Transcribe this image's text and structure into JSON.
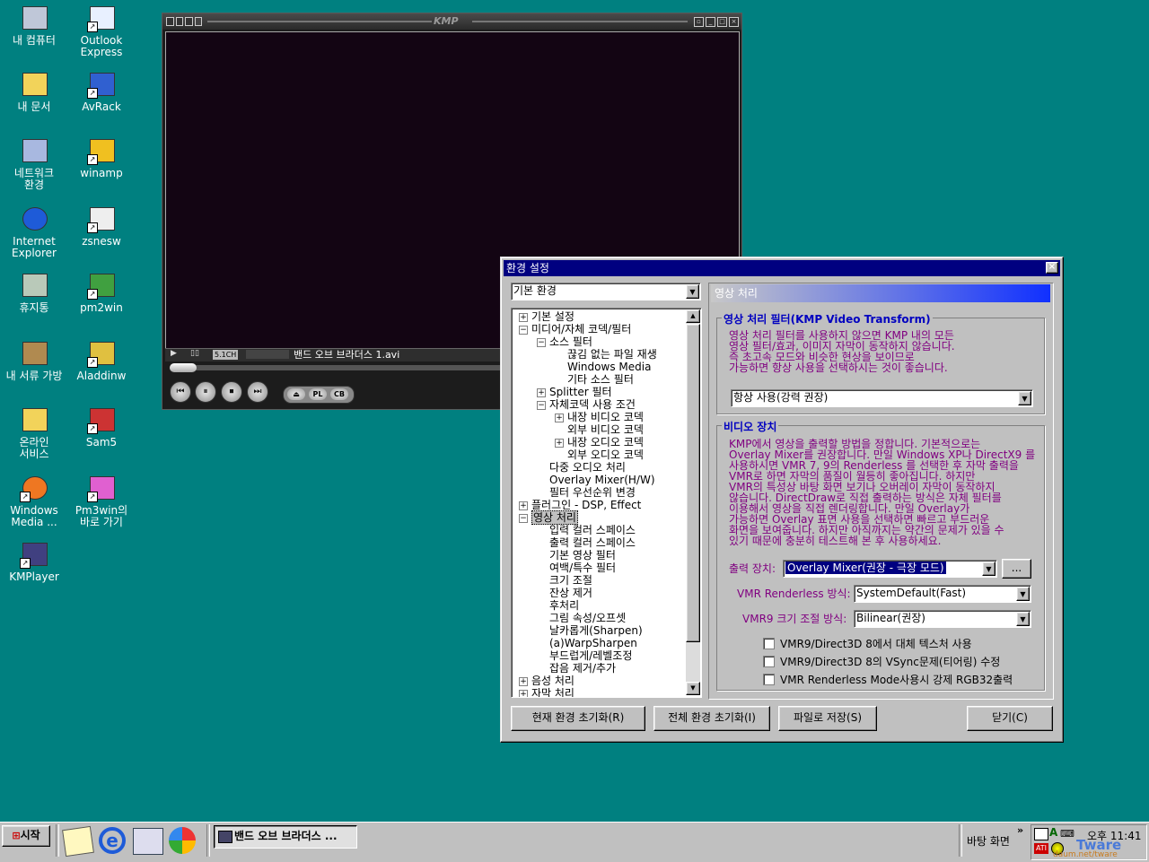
{
  "desktop": {
    "icons": [
      {
        "label": "내 컴퓨터",
        "icon": "computer-icon"
      },
      {
        "label": "Outlook\nExpress",
        "icon": "outlook-icon"
      },
      {
        "label": "내 문서",
        "icon": "folder-icon"
      },
      {
        "label": "AvRack",
        "icon": "avrack-icon"
      },
      {
        "label": "네트워크\n환경",
        "icon": "network-icon"
      },
      {
        "label": "winamp",
        "icon": "winamp-icon"
      },
      {
        "label": "Internet\nExplorer",
        "icon": "ie-icon"
      },
      {
        "label": "zsnesw",
        "icon": "zsnes-icon"
      },
      {
        "label": "휴지통",
        "icon": "recycle-bin-icon"
      },
      {
        "label": "pm2win",
        "icon": "pm2win-icon"
      },
      {
        "label": "내 서류 가방",
        "icon": "briefcase-icon"
      },
      {
        "label": "Aladdinw",
        "icon": "aladdin-icon"
      },
      {
        "label": "온라인\n서비스",
        "icon": "folder-icon"
      },
      {
        "label": "Sam5",
        "icon": "sam5-icon"
      },
      {
        "label": "Windows\nMedia ...",
        "icon": "windows-media-icon"
      },
      {
        "label": "Pm3win의\n바로 가기",
        "icon": "pm3win-icon"
      },
      {
        "label": "KMPlayer",
        "icon": "kmplayer-icon"
      }
    ]
  },
  "player": {
    "title": "KMP",
    "channel_badge": "5.1CH",
    "now_playing": "밴드 오브 브라더스 1.avi",
    "buttons": {
      "eject": "⏏",
      "playlist": "PL",
      "control_box": "CB"
    }
  },
  "dialog": {
    "title": "환경 설정",
    "category_select": "기본 환경",
    "tree": [
      {
        "label": "기본 설정",
        "level": 0,
        "expander": "+"
      },
      {
        "label": "미디어/자체 코덱/필터",
        "level": 0,
        "expander": "-"
      },
      {
        "label": "소스 필터",
        "level": 1,
        "expander": "-"
      },
      {
        "label": "끊김 없는 파일 재생",
        "level": 2,
        "expander": ""
      },
      {
        "label": "Windows Media",
        "level": 2,
        "expander": ""
      },
      {
        "label": "기타 소스 필터",
        "level": 2,
        "expander": ""
      },
      {
        "label": "Splitter 필터",
        "level": 1,
        "expander": "+"
      },
      {
        "label": "자체코덱 사용 조건",
        "level": 1,
        "expander": "-"
      },
      {
        "label": "내장 비디오 코덱",
        "level": 2,
        "expander": "+"
      },
      {
        "label": "외부 비디오 코덱",
        "level": 2,
        "expander": ""
      },
      {
        "label": "내장 오디오 코덱",
        "level": 2,
        "expander": "+"
      },
      {
        "label": "외부 오디오 코덱",
        "level": 2,
        "expander": ""
      },
      {
        "label": "다중 오디오 처리",
        "level": 1,
        "expander": ""
      },
      {
        "label": "Overlay Mixer(H/W)",
        "level": 1,
        "expander": ""
      },
      {
        "label": "필터 우선순위 변경",
        "level": 1,
        "expander": ""
      },
      {
        "label": "플러그인 - DSP, Effect",
        "level": 0,
        "expander": "+"
      },
      {
        "label": "영상 처리",
        "level": 0,
        "expander": "-",
        "selected": true
      },
      {
        "label": "입력 컬러 스페이스",
        "level": 1,
        "expander": ""
      },
      {
        "label": "출력 컬러 스페이스",
        "level": 1,
        "expander": ""
      },
      {
        "label": "기본 영상 필터",
        "level": 1,
        "expander": ""
      },
      {
        "label": "여백/특수 필터",
        "level": 1,
        "expander": ""
      },
      {
        "label": "크기 조절",
        "level": 1,
        "expander": ""
      },
      {
        "label": "잔상 제거",
        "level": 1,
        "expander": ""
      },
      {
        "label": "후처리",
        "level": 1,
        "expander": ""
      },
      {
        "label": "그림 속성/오프셋",
        "level": 1,
        "expander": ""
      },
      {
        "label": "날카롭게(Sharpen)",
        "level": 1,
        "expander": ""
      },
      {
        "label": "(a)WarpSharpen",
        "level": 1,
        "expander": ""
      },
      {
        "label": "부드럽게/레벨조정",
        "level": 1,
        "expander": ""
      },
      {
        "label": "잡음 제거/추가",
        "level": 1,
        "expander": ""
      },
      {
        "label": "음성 처리",
        "level": 0,
        "expander": "+"
      },
      {
        "label": "자막 처리",
        "level": 0,
        "expander": "+"
      }
    ],
    "panel_header": "영상 처리",
    "filter_group": {
      "title": "영상 처리 필터(KMP Video Transform)",
      "desc": [
        "영상 처리 필터를 사용하지 않으면 KMP 내의 모든",
        "영상 필터/효과, 이미지 자막이 동작하지 않습니다.",
        "즉 초고속 모드와 비슷한 현상을 보이므로",
        "가능하면 항상 사용을 선택하시는 것이 좋습니다."
      ],
      "select": "항상 사용(강력 권장)"
    },
    "video_group": {
      "title": "비디오 장치",
      "desc": [
        "KMP에서 영상을 출력할 방법을 정합니다. 기본적으로는",
        "Overlay Mixer를 권장합니다. 만일 Windows XP나 DirectX9 를",
        "사용하시면 VMR 7, 9의 Renderless 를 선택한 후 자막 출력을",
        "VMR로 하면 자막의 품질이 월등히 좋아집니다. 하지만",
        "VMR의 특성상 바탕 화면 보기나 오버레이 자막이 동작하지",
        "않습니다. DirectDraw로 직접 출력하는 방식은 자체 필터를",
        "이용해서 영상을 직접 렌더링합니다. 만일 Overlay가",
        "가능하면 Overlay 표면 사용을 선택하면 빠르고 부드러운",
        "화면을 보여줍니다. 하지만 아직까지는 약간의 문제가 있을 수",
        "있기 때문에 충분히 테스트해 본 후 사용하세요."
      ],
      "output_label": "출력 장치:",
      "output_value": "Overlay Mixer(권장 - 극장 모드)",
      "browse": "...",
      "vmr_mode_label": "VMR Renderless 방식:",
      "vmr_mode_value": "SystemDefault(Fast)",
      "vmr9_size_label": "VMR9 크기 조절 방식:",
      "vmr9_size_value": "Bilinear(권장)",
      "checks": [
        "VMR9/Direct3D 8에서 대체 텍스처 사용",
        "VMR9/Direct3D 8의 VSync문제(티어링) 수정",
        "VMR Renderless Mode사용시 강제 RGB32출력"
      ]
    },
    "buttons": {
      "reset_current": "현재 환경 초기화(R)",
      "reset_all": "전체 환경 초기화(I)",
      "save_file": "파일로 저장(S)",
      "close": "닫기(C)"
    }
  },
  "taskbar": {
    "start": "시작",
    "task": "밴드 오브 브라더스 ...",
    "desktop_toolbar": "바탕 화면",
    "clock": "오후 11:41",
    "watermark1": "Tware",
    "watermark2": "daum.net/tware"
  }
}
